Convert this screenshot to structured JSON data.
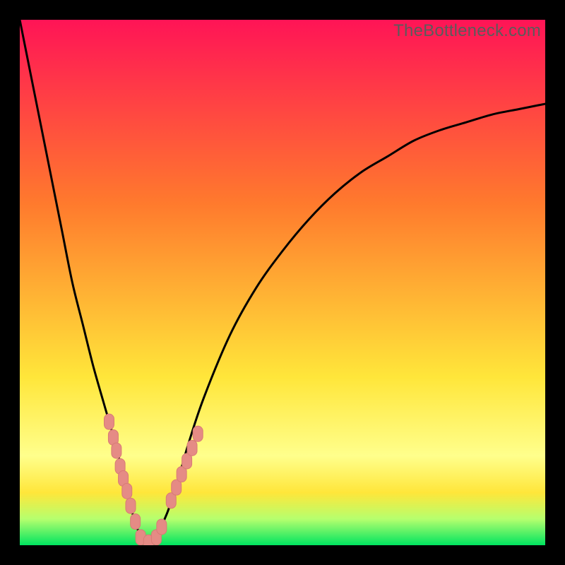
{
  "watermark": "TheBottleneck.com",
  "colors": {
    "bg_top": "#ff1456",
    "bg_mid1": "#ff7a2d",
    "bg_mid2": "#ffe63a",
    "bg_band_light": "#ffff8c",
    "bg_band_green_light": "#b6ff6e",
    "bg_bottom": "#00e460",
    "curve": "#000000",
    "marker_fill": "#e58b85",
    "marker_stroke": "#d87b75"
  },
  "chart_data": {
    "type": "line",
    "title": "",
    "xlabel": "",
    "ylabel": "",
    "xlim": [
      0,
      100
    ],
    "ylim": [
      0,
      100
    ],
    "series": [
      {
        "name": "bottleneck-curve",
        "x": [
          0,
          2,
          4,
          6,
          8,
          10,
          12,
          14,
          16,
          18,
          20,
          21,
          22,
          23,
          24,
          26,
          28,
          30,
          32,
          35,
          40,
          45,
          50,
          55,
          60,
          65,
          70,
          75,
          80,
          85,
          90,
          95,
          100
        ],
        "y": [
          100,
          90,
          80,
          70,
          60,
          50,
          42,
          34,
          27,
          20,
          12,
          8,
          4,
          2,
          0,
          2,
          6,
          12,
          19,
          28,
          40,
          49,
          56,
          62,
          67,
          71,
          74,
          77,
          79,
          80.5,
          82,
          83,
          84
        ]
      }
    ],
    "markers": {
      "name": "data-points",
      "points": [
        {
          "x": 17.0,
          "y": 23.5
        },
        {
          "x": 17.8,
          "y": 20.5
        },
        {
          "x": 18.4,
          "y": 18.0
        },
        {
          "x": 19.1,
          "y": 15.0
        },
        {
          "x": 19.7,
          "y": 12.7
        },
        {
          "x": 20.4,
          "y": 10.3
        },
        {
          "x": 21.1,
          "y": 7.5
        },
        {
          "x": 22.0,
          "y": 4.5
        },
        {
          "x": 23.0,
          "y": 1.5
        },
        {
          "x": 24.5,
          "y": 0.5
        },
        {
          "x": 26.0,
          "y": 1.5
        },
        {
          "x": 27.0,
          "y": 3.5
        },
        {
          "x": 28.8,
          "y": 8.5
        },
        {
          "x": 29.8,
          "y": 11.0
        },
        {
          "x": 30.8,
          "y": 13.5
        },
        {
          "x": 31.8,
          "y": 16.0
        },
        {
          "x": 32.8,
          "y": 18.5
        },
        {
          "x": 33.9,
          "y": 21.2
        }
      ]
    }
  }
}
